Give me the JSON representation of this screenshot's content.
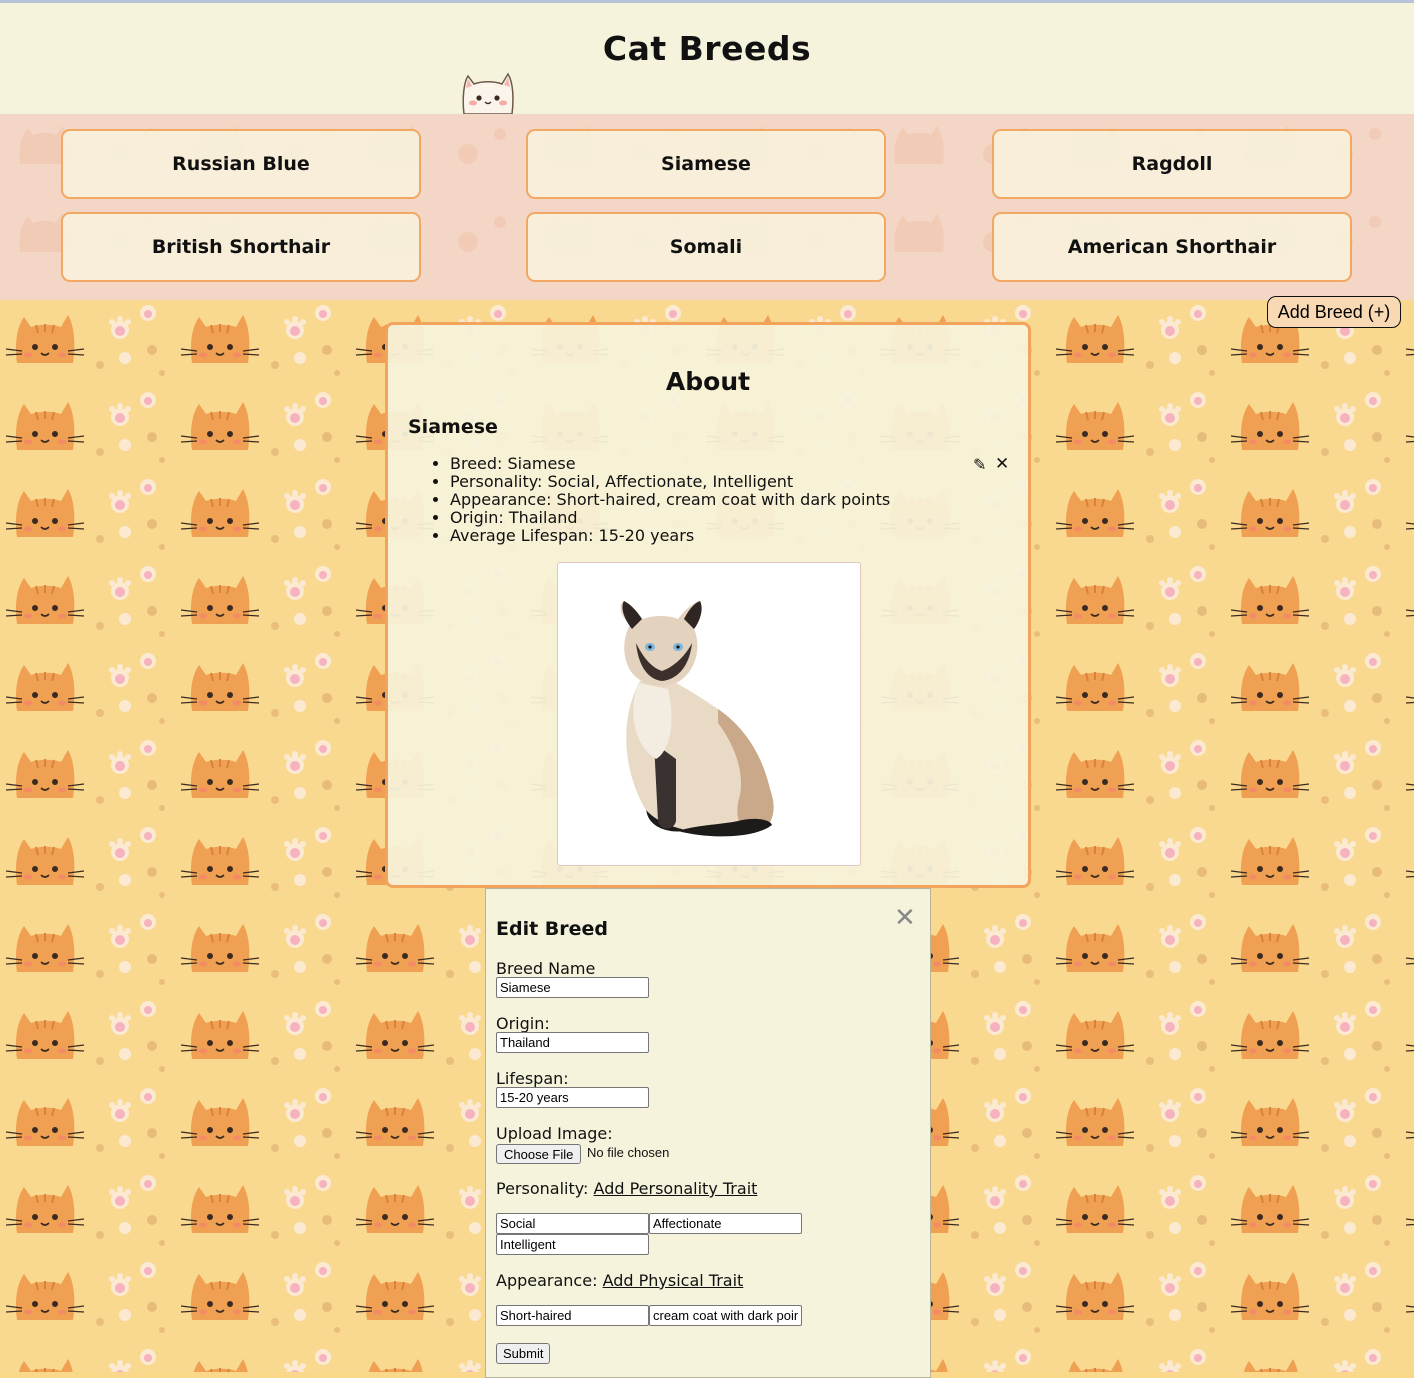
{
  "page": {
    "title": "Cat Breeds"
  },
  "breeds": [
    "Russian Blue",
    "Siamese",
    "Ragdoll",
    "British Shorthair",
    "Somali",
    "American Shorthair"
  ],
  "add_breed_label": "Add Breed (+)",
  "about": {
    "heading": "About",
    "breed_name": "Siamese",
    "details": [
      "Breed: Siamese",
      "Personality: Social, Affectionate, Intelligent",
      "Appearance: Short-haired, cream coat with dark points",
      "Origin: Thailand",
      "Average Lifespan: 15-20 years"
    ],
    "edit_icon": "✎",
    "delete_icon": "✕"
  },
  "edit_form": {
    "heading": "Edit Breed",
    "close_icon": "✕",
    "breed_name_label": "Breed Name",
    "breed_name_value": "Siamese",
    "origin_label": "Origin:",
    "origin_value": "Thailand",
    "lifespan_label": "Lifespan:",
    "lifespan_value": "15-20 years",
    "upload_label": "Upload Image:",
    "choose_file_label": "Choose File",
    "file_status": "No file chosen",
    "personality_label": "Personality:",
    "add_personality_link": "Add Personality Trait",
    "personality_traits": [
      "Social",
      "Affectionate",
      "Intelligent"
    ],
    "appearance_label": "Appearance:",
    "add_physical_link": "Add Physical Trait",
    "physical_traits": [
      "Short-haired",
      "cream coat with dark points"
    ],
    "submit_label": "Submit"
  },
  "colors": {
    "accent_border": "#f2a45d",
    "band_bg": "#f3d6c6",
    "pattern_bg": "#f9d98f",
    "cat_orange": "#f0a052"
  }
}
